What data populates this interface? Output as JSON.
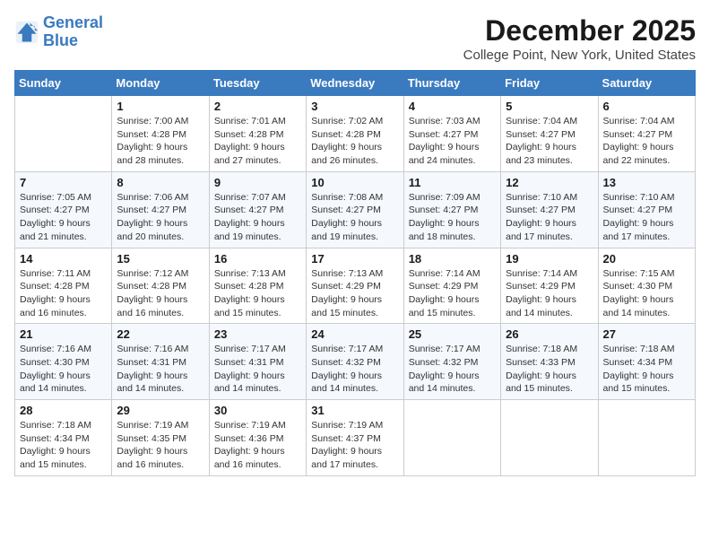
{
  "logo": {
    "line1": "General",
    "line2": "Blue"
  },
  "title": "December 2025",
  "subtitle": "College Point, New York, United States",
  "headers": [
    "Sunday",
    "Monday",
    "Tuesday",
    "Wednesday",
    "Thursday",
    "Friday",
    "Saturday"
  ],
  "weeks": [
    [
      {
        "num": "",
        "info": ""
      },
      {
        "num": "1",
        "info": "Sunrise: 7:00 AM\nSunset: 4:28 PM\nDaylight: 9 hours\nand 28 minutes."
      },
      {
        "num": "2",
        "info": "Sunrise: 7:01 AM\nSunset: 4:28 PM\nDaylight: 9 hours\nand 27 minutes."
      },
      {
        "num": "3",
        "info": "Sunrise: 7:02 AM\nSunset: 4:28 PM\nDaylight: 9 hours\nand 26 minutes."
      },
      {
        "num": "4",
        "info": "Sunrise: 7:03 AM\nSunset: 4:27 PM\nDaylight: 9 hours\nand 24 minutes."
      },
      {
        "num": "5",
        "info": "Sunrise: 7:04 AM\nSunset: 4:27 PM\nDaylight: 9 hours\nand 23 minutes."
      },
      {
        "num": "6",
        "info": "Sunrise: 7:04 AM\nSunset: 4:27 PM\nDaylight: 9 hours\nand 22 minutes."
      }
    ],
    [
      {
        "num": "7",
        "info": "Sunrise: 7:05 AM\nSunset: 4:27 PM\nDaylight: 9 hours\nand 21 minutes."
      },
      {
        "num": "8",
        "info": "Sunrise: 7:06 AM\nSunset: 4:27 PM\nDaylight: 9 hours\nand 20 minutes."
      },
      {
        "num": "9",
        "info": "Sunrise: 7:07 AM\nSunset: 4:27 PM\nDaylight: 9 hours\nand 19 minutes."
      },
      {
        "num": "10",
        "info": "Sunrise: 7:08 AM\nSunset: 4:27 PM\nDaylight: 9 hours\nand 19 minutes."
      },
      {
        "num": "11",
        "info": "Sunrise: 7:09 AM\nSunset: 4:27 PM\nDaylight: 9 hours\nand 18 minutes."
      },
      {
        "num": "12",
        "info": "Sunrise: 7:10 AM\nSunset: 4:27 PM\nDaylight: 9 hours\nand 17 minutes."
      },
      {
        "num": "13",
        "info": "Sunrise: 7:10 AM\nSunset: 4:27 PM\nDaylight: 9 hours\nand 17 minutes."
      }
    ],
    [
      {
        "num": "14",
        "info": "Sunrise: 7:11 AM\nSunset: 4:28 PM\nDaylight: 9 hours\nand 16 minutes."
      },
      {
        "num": "15",
        "info": "Sunrise: 7:12 AM\nSunset: 4:28 PM\nDaylight: 9 hours\nand 16 minutes."
      },
      {
        "num": "16",
        "info": "Sunrise: 7:13 AM\nSunset: 4:28 PM\nDaylight: 9 hours\nand 15 minutes."
      },
      {
        "num": "17",
        "info": "Sunrise: 7:13 AM\nSunset: 4:29 PM\nDaylight: 9 hours\nand 15 minutes."
      },
      {
        "num": "18",
        "info": "Sunrise: 7:14 AM\nSunset: 4:29 PM\nDaylight: 9 hours\nand 15 minutes."
      },
      {
        "num": "19",
        "info": "Sunrise: 7:14 AM\nSunset: 4:29 PM\nDaylight: 9 hours\nand 14 minutes."
      },
      {
        "num": "20",
        "info": "Sunrise: 7:15 AM\nSunset: 4:30 PM\nDaylight: 9 hours\nand 14 minutes."
      }
    ],
    [
      {
        "num": "21",
        "info": "Sunrise: 7:16 AM\nSunset: 4:30 PM\nDaylight: 9 hours\nand 14 minutes."
      },
      {
        "num": "22",
        "info": "Sunrise: 7:16 AM\nSunset: 4:31 PM\nDaylight: 9 hours\nand 14 minutes."
      },
      {
        "num": "23",
        "info": "Sunrise: 7:17 AM\nSunset: 4:31 PM\nDaylight: 9 hours\nand 14 minutes."
      },
      {
        "num": "24",
        "info": "Sunrise: 7:17 AM\nSunset: 4:32 PM\nDaylight: 9 hours\nand 14 minutes."
      },
      {
        "num": "25",
        "info": "Sunrise: 7:17 AM\nSunset: 4:32 PM\nDaylight: 9 hours\nand 14 minutes."
      },
      {
        "num": "26",
        "info": "Sunrise: 7:18 AM\nSunset: 4:33 PM\nDaylight: 9 hours\nand 15 minutes."
      },
      {
        "num": "27",
        "info": "Sunrise: 7:18 AM\nSunset: 4:34 PM\nDaylight: 9 hours\nand 15 minutes."
      }
    ],
    [
      {
        "num": "28",
        "info": "Sunrise: 7:18 AM\nSunset: 4:34 PM\nDaylight: 9 hours\nand 15 minutes."
      },
      {
        "num": "29",
        "info": "Sunrise: 7:19 AM\nSunset: 4:35 PM\nDaylight: 9 hours\nand 16 minutes."
      },
      {
        "num": "30",
        "info": "Sunrise: 7:19 AM\nSunset: 4:36 PM\nDaylight: 9 hours\nand 16 minutes."
      },
      {
        "num": "31",
        "info": "Sunrise: 7:19 AM\nSunset: 4:37 PM\nDaylight: 9 hours\nand 17 minutes."
      },
      {
        "num": "",
        "info": ""
      },
      {
        "num": "",
        "info": ""
      },
      {
        "num": "",
        "info": ""
      }
    ]
  ]
}
